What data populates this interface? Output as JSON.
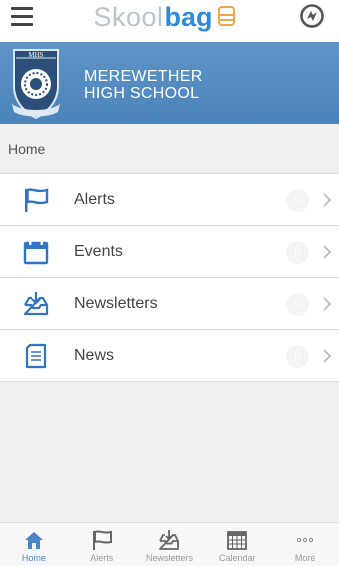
{
  "app": {
    "brand_light": "Skool",
    "brand_bold": "bag",
    "brand_icon": "bag-icon",
    "colors": {
      "brand_blue": "#2f8bd6",
      "banner": "#4b84bb",
      "accent_blue": "#2f75c4",
      "badge": "#f4f4f4"
    }
  },
  "banner": {
    "crest_text": "MHS",
    "school_line1": "MEREWETHER",
    "school_line2": "HIGH SCHOOL"
  },
  "breadcrumb": {
    "label": "Home"
  },
  "menu": {
    "items": [
      {
        "label": "Alerts",
        "count": "0",
        "icon": "flag-icon"
      },
      {
        "label": "Events",
        "count": "0",
        "icon": "calendar-icon"
      },
      {
        "label": "Newsletters",
        "count": "0",
        "icon": "inbox-download-icon"
      },
      {
        "label": "News",
        "count": "0",
        "icon": "document-icon"
      }
    ]
  },
  "tabbar": {
    "tabs": [
      {
        "label": "Home",
        "icon": "home-icon",
        "active": true
      },
      {
        "label": "Alerts",
        "icon": "flag-icon",
        "active": false
      },
      {
        "label": "Newsletters",
        "icon": "inbox-download-icon",
        "active": false
      },
      {
        "label": "Calendar",
        "icon": "calendar-grid-icon",
        "active": false
      },
      {
        "label": "More",
        "icon": "more-dots-icon",
        "active": false
      }
    ]
  }
}
